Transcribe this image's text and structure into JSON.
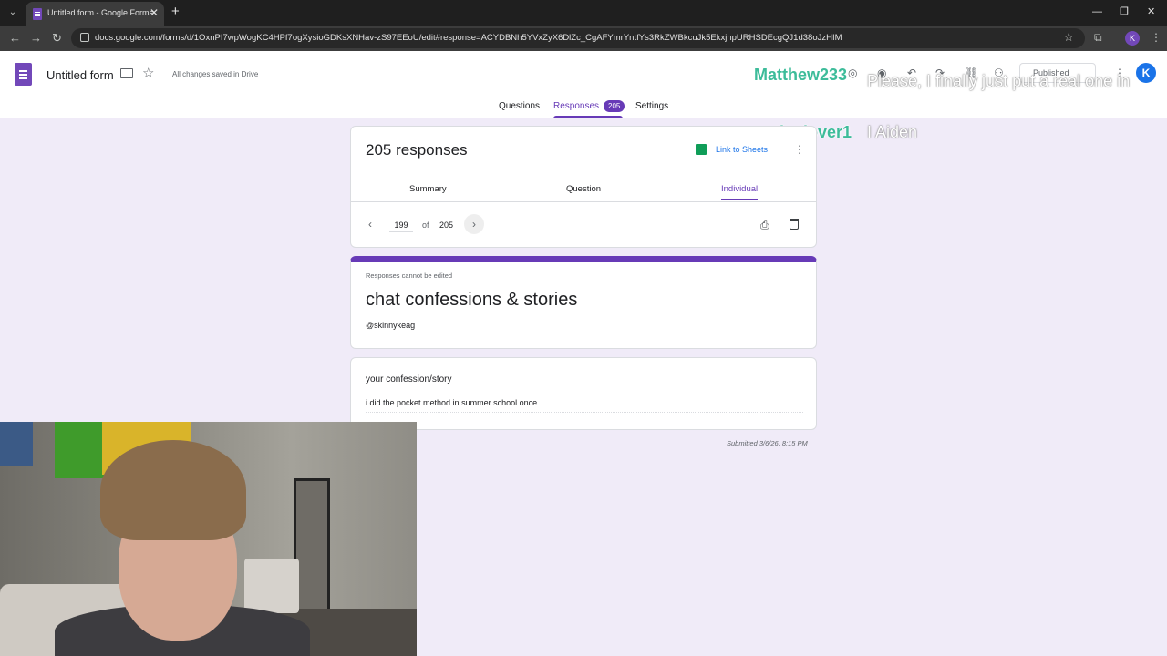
{
  "browser": {
    "tab_title": "Untitled form - Google Forms",
    "url": "docs.google.com/forms/d/1OxnPI7wpWogKC4HPf7ogXysioGDKsXNHav-zS97EEoU/edit#response=ACYDBNh5YVxZyX6DlZc_CgAFYmrYntfYs3RkZWBkcuJk5EkxjhpURHSDEcgQJ1d38oJzHIM",
    "profile_initial": "K"
  },
  "header": {
    "doc_title": "Untitled form",
    "save_status": "All changes saved in Drive",
    "publish_label": "Published",
    "avatar_initial": "K",
    "tabs": {
      "questions": "Questions",
      "responses": "Responses",
      "responses_count": "205",
      "settings": "Settings"
    }
  },
  "chat_overlay": [
    {
      "user": "Matthew233",
      "message": "Please, I finally just put a real one in"
    },
    {
      "user": "srtlenlover1",
      "message": "I Aiden"
    }
  ],
  "responses_card": {
    "title": "205 responses",
    "link_label": "Link to Sheets",
    "subtabs": {
      "summary": "Summary",
      "question": "Question",
      "individual": "Individual"
    },
    "pager": {
      "current": "199",
      "of": "of",
      "total": "205"
    }
  },
  "form_card": {
    "notice": "Responses cannot be edited",
    "title": "chat confessions & stories",
    "description": "@skinnykeag"
  },
  "question_card": {
    "question": "your confession/story",
    "answer": "i did the pocket  method in summer school once"
  },
  "submitted": "Submitted 3/6/26, 8:15 PM",
  "colors": {
    "accent": "#673ab7",
    "background": "#f0ebf8",
    "sheets_green": "#0f9d58",
    "chat_user": "#3dbc9a"
  }
}
